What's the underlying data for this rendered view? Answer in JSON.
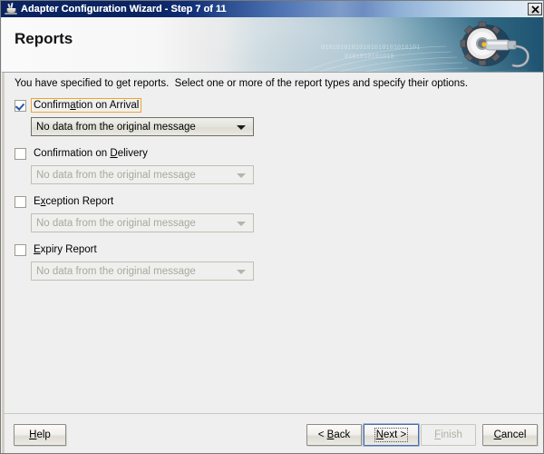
{
  "window": {
    "title": "Adapter Configuration Wizard - Step 7 of 11",
    "app_icon": "java-coffee-cup-icon",
    "close_label": "close-icon"
  },
  "banner": {
    "heading": "Reports",
    "graphic": "gear-and-wrench-icon",
    "binary_line_1": "01010101010101010101010101",
    "binary_line_2": "0101010101010"
  },
  "content": {
    "instruction": "You have specified to get reports.  Select one or more of the report types and specify their options.",
    "options": [
      {
        "label_prefix": "Confirm",
        "label_mnemonic": "a",
        "label_suffix": "tion on Arrival",
        "checked": true,
        "focused": true,
        "combo_value": "No data from the original message",
        "combo_enabled": true
      },
      {
        "label_prefix": "Confirmation on ",
        "label_mnemonic": "D",
        "label_suffix": "elivery",
        "checked": false,
        "focused": false,
        "combo_value": "No data from the original message",
        "combo_enabled": false
      },
      {
        "label_prefix": "E",
        "label_mnemonic": "x",
        "label_suffix": "ception Report",
        "checked": false,
        "focused": false,
        "combo_value": "No data from the original message",
        "combo_enabled": false
      },
      {
        "label_prefix": "",
        "label_mnemonic": "E",
        "label_suffix": "xpiry Report",
        "checked": false,
        "focused": false,
        "combo_value": "No data from the original message",
        "combo_enabled": false
      }
    ]
  },
  "buttons": {
    "help": {
      "prefix": "",
      "mnemonic": "H",
      "suffix": "elp",
      "disabled": false,
      "focused": false
    },
    "back": {
      "prefix": "< ",
      "mnemonic": "B",
      "suffix": "ack",
      "disabled": false,
      "focused": false
    },
    "next": {
      "prefix": "",
      "mnemonic": "N",
      "suffix": "ext >",
      "disabled": false,
      "focused": true
    },
    "finish": {
      "prefix": "",
      "mnemonic": "F",
      "suffix": "inish",
      "disabled": true,
      "focused": false
    },
    "cancel": {
      "prefix": "",
      "mnemonic": "C",
      "suffix": "ancel",
      "disabled": false,
      "focused": false
    }
  },
  "colors": {
    "titlebar_start": "#0a2361",
    "titlebar_end": "#e4eef7",
    "banner_end": "#1d5370",
    "content_bg": "#efefef",
    "focus_outline": "#e8a33d",
    "checkmark": "#2457a7",
    "disabled_text": "#aaa89a"
  }
}
